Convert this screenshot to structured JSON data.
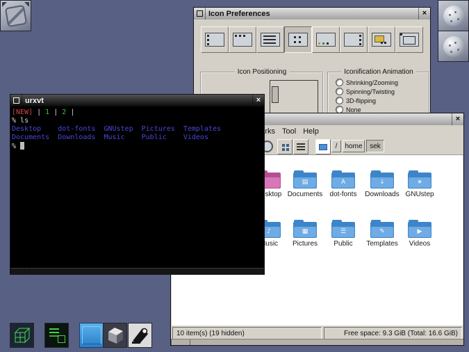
{
  "desktop": {
    "background_color": "#586083"
  },
  "chrome": {
    "close_glyph": "×"
  },
  "icon_preferences": {
    "title": "Icon Preferences",
    "toolbar_preset_icons": [
      "preset-left-column-icon",
      "preset-top-row-icon",
      "preset-list-icon",
      "preset-grid-icon",
      "preset-bottom-row-icon",
      "preset-right-column-icon",
      "preset-folder-icon",
      "preset-screen-icon"
    ],
    "selected_preset_index": 3,
    "positioning_group_label": "Icon Positioning",
    "animation_group_label": "Iconification Animation",
    "animation_options": [
      "Shrinking/Zooming",
      "Spinning/Twisting",
      "3D-flipping",
      "None"
    ]
  },
  "terminal": {
    "title": "urxvt",
    "status": {
      "badge": "[NEW]",
      "sep1": " | ",
      "screen1": "1",
      "sep2": " | ",
      "screen2": "2",
      "sep3": " |"
    },
    "prompt": "%",
    "command": " ls",
    "ls_output_row1": "Desktop    dot-fonts  GNUstep  Pictures  Templates",
    "ls_output_row2": "Documents  Downloads  Music    Public    Videos",
    "colors": {
      "badge": "#d24444",
      "screen_number": "#3cc43c",
      "files": "#4848dc",
      "foreground": "#d8d8d8"
    }
  },
  "file_manager": {
    "menu_items": [
      "Bookmarks",
      "Tool",
      "Help"
    ],
    "toolbar_icons": [
      "round-icon",
      "icon-view-icon",
      "list-view-icon",
      "folder-button-icon"
    ],
    "path_segments": {
      "root": "/",
      "home": "home",
      "current": "sek"
    },
    "folders": [
      {
        "name": "Desktop",
        "glyph": "",
        "back": "#b44f92",
        "front": "#d877b8"
      },
      {
        "name": "Documents",
        "glyph": "▤",
        "back": "#3d85c8",
        "front": "#6fabe4"
      },
      {
        "name": "dot-fonts",
        "glyph": "A",
        "back": "#3d85c8",
        "front": "#6fabe4"
      },
      {
        "name": "Downloads",
        "glyph": "↓",
        "back": "#3d85c8",
        "front": "#6fabe4"
      },
      {
        "name": "GNUstep",
        "glyph": "∗",
        "back": "#3d85c8",
        "front": "#6fabe4"
      },
      {
        "name": "Music",
        "glyph": "♪",
        "back": "#3d85c8",
        "front": "#6fabe4"
      },
      {
        "name": "Pictures",
        "glyph": "▦",
        "back": "#3d85c8",
        "front": "#6fabe4"
      },
      {
        "name": "Public",
        "glyph": "☰",
        "back": "#3d85c8",
        "front": "#6fabe4"
      },
      {
        "name": "Templates",
        "glyph": "✎",
        "back": "#3d85c8",
        "front": "#6fabe4"
      },
      {
        "name": "Videos",
        "glyph": "▶",
        "back": "#3d85c8",
        "front": "#6fabe4"
      }
    ],
    "status_left": "10 item(s) (19 hidden)",
    "status_right": "Free space: 9.3 GiB (Total: 16.6 GiB)"
  },
  "dock": {
    "clip_tile_icon": "paperclip-tile-icon",
    "top_right_tile_icons": [
      "sphere-appicon",
      "sphere-appicon"
    ],
    "bottom_tile_icons": [
      "green-wireframe-cube-appicon",
      "terminal-cube-appicon",
      "blue-window-appicon",
      "gray-cube-appicon",
      "speaker-horn-appicon"
    ]
  }
}
